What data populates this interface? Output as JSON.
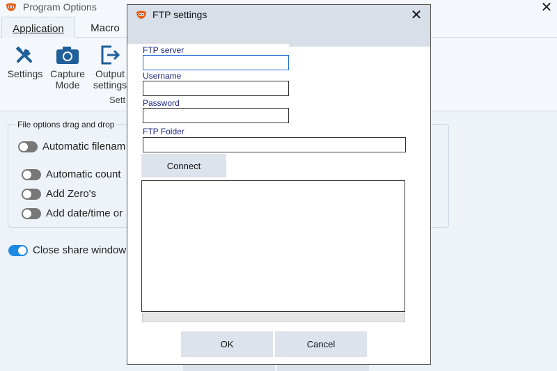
{
  "background_window": {
    "title": "Program Options",
    "close_glyph": "✕",
    "tabs": [
      {
        "label": "Application",
        "active": true
      },
      {
        "label": "Macro",
        "active": false
      }
    ],
    "ribbon": {
      "buttons": [
        {
          "label_1": "Settings",
          "label_2": "",
          "icon": "tools-icon"
        },
        {
          "label_1": "Capture",
          "label_2": "Mode",
          "icon": "camera-icon"
        },
        {
          "label_1": "Output",
          "label_2": "settings",
          "icon": "export-icon"
        }
      ],
      "group_label": "Sett"
    },
    "file_options": {
      "legend": "File options drag and drop",
      "items": [
        {
          "label": "Automatic filenam",
          "on": false
        },
        {
          "label": "Automatic count",
          "on": false
        },
        {
          "label": "Add Zero's",
          "on": false
        },
        {
          "label": "Add date/time or",
          "on": false
        }
      ]
    },
    "close_share": {
      "label": "Close share window",
      "on": true
    }
  },
  "ftp_dialog": {
    "title": "FTP settings",
    "close_glyph": "✕",
    "fields": {
      "server": {
        "label": "FTP server",
        "value": ""
      },
      "username": {
        "label": "Username",
        "value": ""
      },
      "password": {
        "label": "Password",
        "value": ""
      },
      "folder": {
        "label": "FTP Folder",
        "value": ""
      }
    },
    "connect_label": "Connect",
    "ok_label": "OK",
    "cancel_label": "Cancel"
  },
  "colors": {
    "accent": "#1e88e5",
    "logo_orange": "#e8601c"
  }
}
